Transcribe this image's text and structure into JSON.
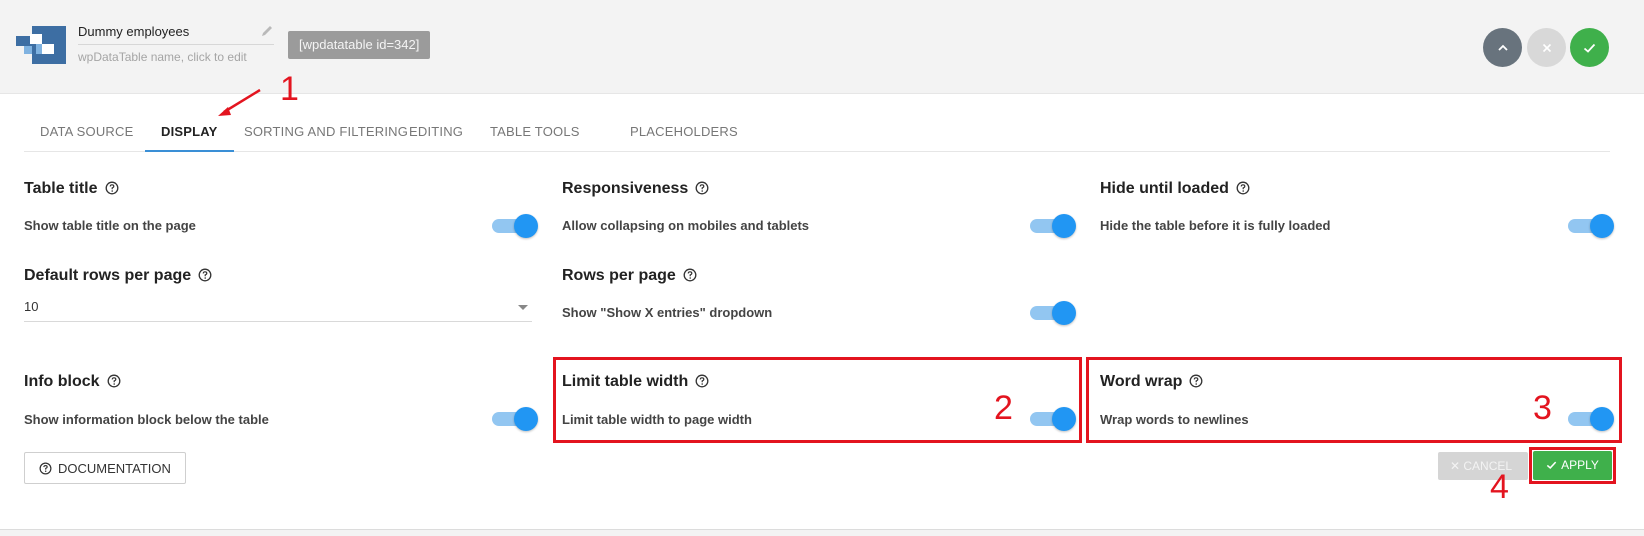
{
  "header": {
    "table_name": "Dummy employees",
    "name_hint": "wpDataTable name, click to edit",
    "shortcode": "[wpdatatable id=342]"
  },
  "tabs": [
    {
      "label": "DATA SOURCE",
      "active": false
    },
    {
      "label": "DISPLAY",
      "active": true
    },
    {
      "label": "SORTING AND FILTERING",
      "active": false
    },
    {
      "label": "EDITING",
      "active": false
    },
    {
      "label": "TABLE TOOLS",
      "active": false
    },
    {
      "label": "PLACEHOLDERS",
      "active": false
    }
  ],
  "settings": {
    "table_title": {
      "title": "Table title",
      "desc": "Show table title on the page",
      "enabled": true
    },
    "responsiveness": {
      "title": "Responsiveness",
      "desc": "Allow collapsing on mobiles and tablets",
      "enabled": true
    },
    "hide_until_loaded": {
      "title": "Hide until loaded",
      "desc": "Hide the table before it is fully loaded",
      "enabled": true
    },
    "default_rows": {
      "title": "Default rows per page",
      "value": "10"
    },
    "rows_per_page": {
      "title": "Rows per page",
      "desc": "Show \"Show X entries\" dropdown",
      "enabled": true
    },
    "info_block": {
      "title": "Info block",
      "desc": "Show information block below the table",
      "enabled": true
    },
    "limit_width": {
      "title": "Limit table width",
      "desc": "Limit table width to page width",
      "enabled": true
    },
    "word_wrap": {
      "title": "Word wrap",
      "desc": "Wrap words to newlines",
      "enabled": true
    }
  },
  "annotations": [
    "1",
    "2",
    "3",
    "4"
  ],
  "footer": {
    "documentation": "DOCUMENTATION",
    "cancel": "✕ CANCEL",
    "apply": "APPLY"
  },
  "colors": {
    "accent_blue": "#2196f3",
    "apply_green": "#3fb04b",
    "annotation_red": "#e3141f"
  },
  "icons": [
    "table-logo-icon",
    "pencil-icon",
    "chevron-up-icon",
    "close-icon",
    "check-icon",
    "help-circle-icon",
    "arrow-annotation-icon"
  ]
}
